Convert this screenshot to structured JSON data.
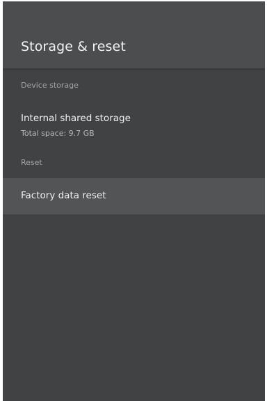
{
  "header": {
    "title": "Storage & reset"
  },
  "sections": {
    "device_storage_label": "Device storage",
    "reset_label": "Reset"
  },
  "items": {
    "internal_storage": {
      "title": "Internal shared storage",
      "subtitle": "Total space: 9.7 GB"
    },
    "factory_reset": {
      "title": "Factory data reset"
    }
  }
}
